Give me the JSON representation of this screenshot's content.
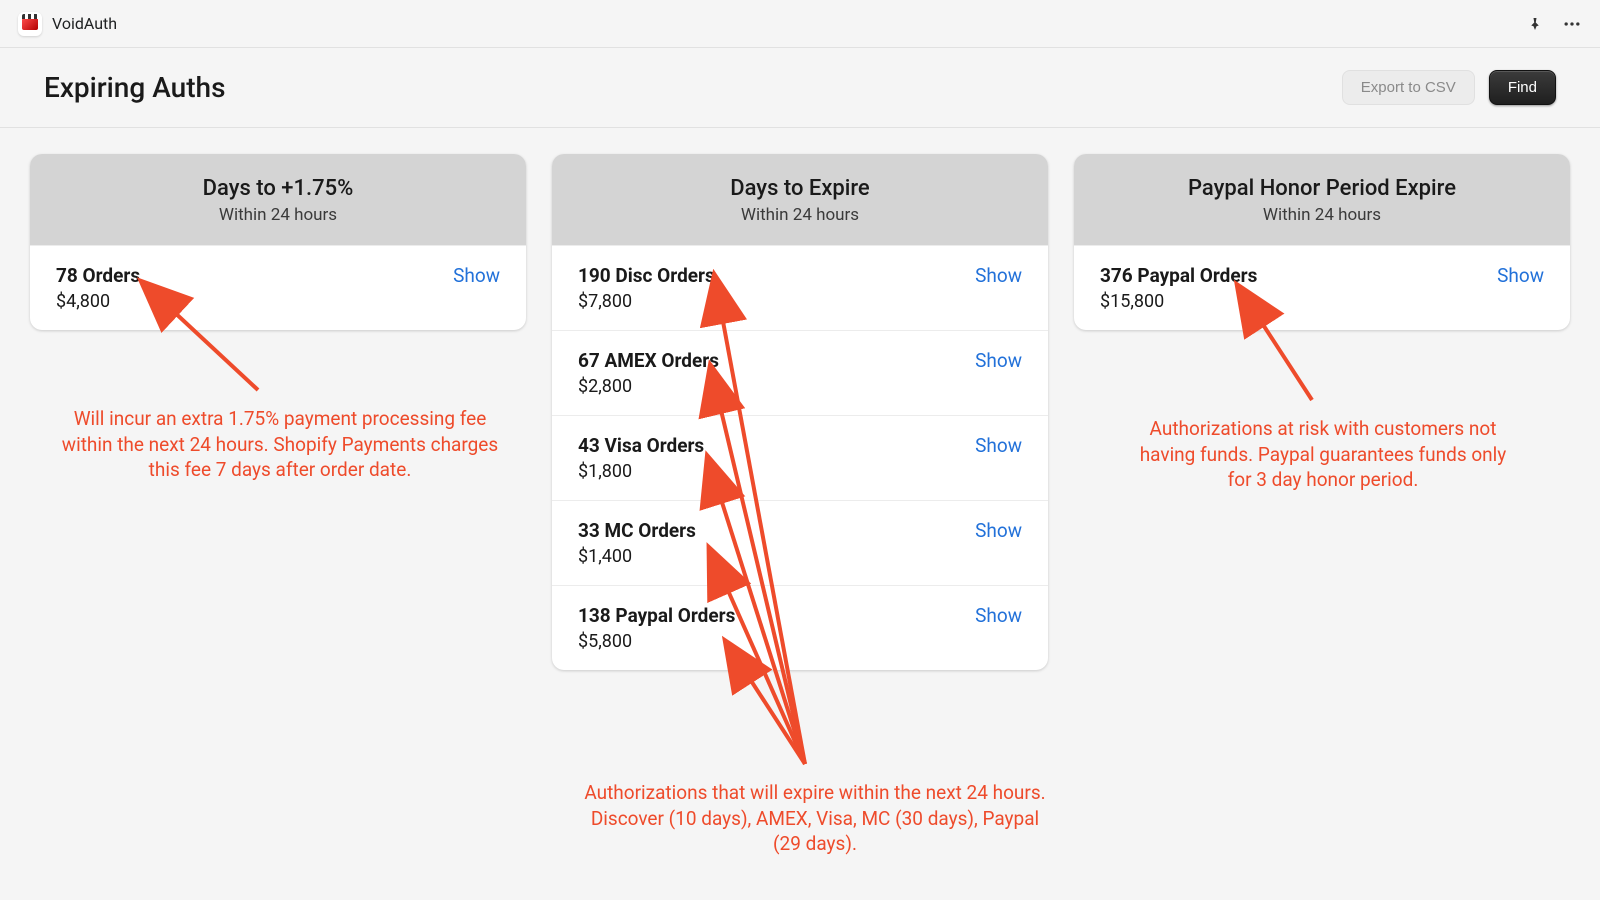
{
  "app": {
    "name": "VoidAuth"
  },
  "header": {
    "title": "Expiring Auths",
    "export_label": "Export to CSV",
    "find_label": "Find"
  },
  "cards": [
    {
      "title": "Days to +1.75%",
      "subtitle": "Within 24 hours",
      "rows": [
        {
          "title": "78 Orders",
          "amount": "$4,800",
          "action": "Show"
        }
      ]
    },
    {
      "title": "Days to Expire",
      "subtitle": "Within 24 hours",
      "rows": [
        {
          "title": "190 Disc Orders",
          "amount": "$7,800",
          "action": "Show"
        },
        {
          "title": "67 AMEX Orders",
          "amount": "$2,800",
          "action": "Show"
        },
        {
          "title": "43 Visa Orders",
          "amount": "$1,800",
          "action": "Show"
        },
        {
          "title": "33 MC Orders",
          "amount": "$1,400",
          "action": "Show"
        },
        {
          "title": "138 Paypal Orders",
          "amount": "$5,800",
          "action": "Show"
        }
      ]
    },
    {
      "title": "Paypal Honor Period Expire",
      "subtitle": "Within 24 hours",
      "rows": [
        {
          "title": "376 Paypal Orders",
          "amount": "$15,800",
          "action": "Show"
        }
      ]
    }
  ],
  "annotations": {
    "left": "Will incur an extra 1.75% payment processing fee within the next 24 hours.  Shopify Payments charges this fee 7 days after order date.",
    "middle": "Authorizations that will expire within the next 24 hours.  Discover (10 days), AMEX, Visa, MC (30 days), Paypal (29 days).",
    "right": "Authorizations at risk with customers not having funds.  Paypal guarantees funds only for 3 day honor period."
  }
}
